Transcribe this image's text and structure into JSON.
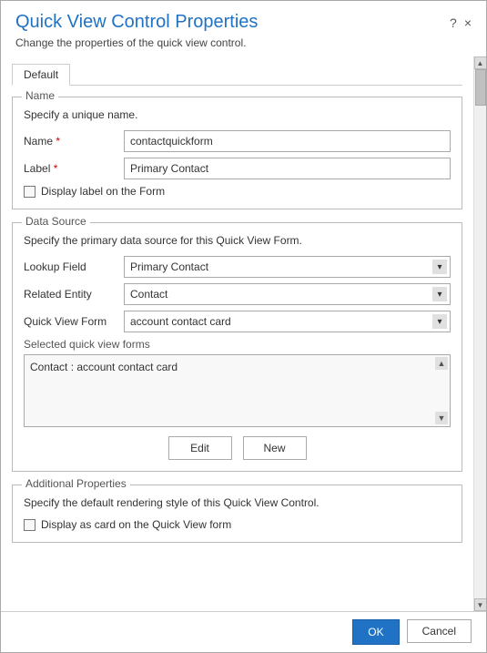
{
  "dialog": {
    "title": "Quick View Control Properties",
    "subtitle": "Change the properties of the quick view control.",
    "help_icon": "?",
    "close_icon": "×"
  },
  "tabs": [
    {
      "label": "Default",
      "active": true
    }
  ],
  "name_section": {
    "legend": "Name",
    "description": "Specify a unique name.",
    "name_label": "Name",
    "name_required": true,
    "name_value": "contactquickform",
    "label_label": "Label",
    "label_required": true,
    "label_value": "Primary Contact",
    "checkbox_label": "Display label on the Form"
  },
  "datasource_section": {
    "legend": "Data Source",
    "description": "Specify the primary data source for this Quick View Form.",
    "lookup_field_label": "Lookup Field",
    "lookup_field_value": "Primary Contact",
    "lookup_options": [
      "Primary Contact"
    ],
    "related_entity_label": "Related Entity",
    "related_entity_value": "Contact",
    "related_entity_options": [
      "Contact"
    ],
    "quick_view_form_label": "Quick View Form",
    "quick_view_form_value": "account contact card",
    "quick_view_form_options": [
      "account contact card"
    ],
    "selected_label": "Selected quick view forms",
    "selected_item": "Contact : account contact card",
    "edit_button": "Edit",
    "new_button": "New"
  },
  "additional_section": {
    "legend": "Additional Properties",
    "description": "Specify the default rendering style of this Quick View Control.",
    "checkbox_label": "Display as card on the Quick View form"
  },
  "footer": {
    "ok_label": "OK",
    "cancel_label": "Cancel"
  }
}
